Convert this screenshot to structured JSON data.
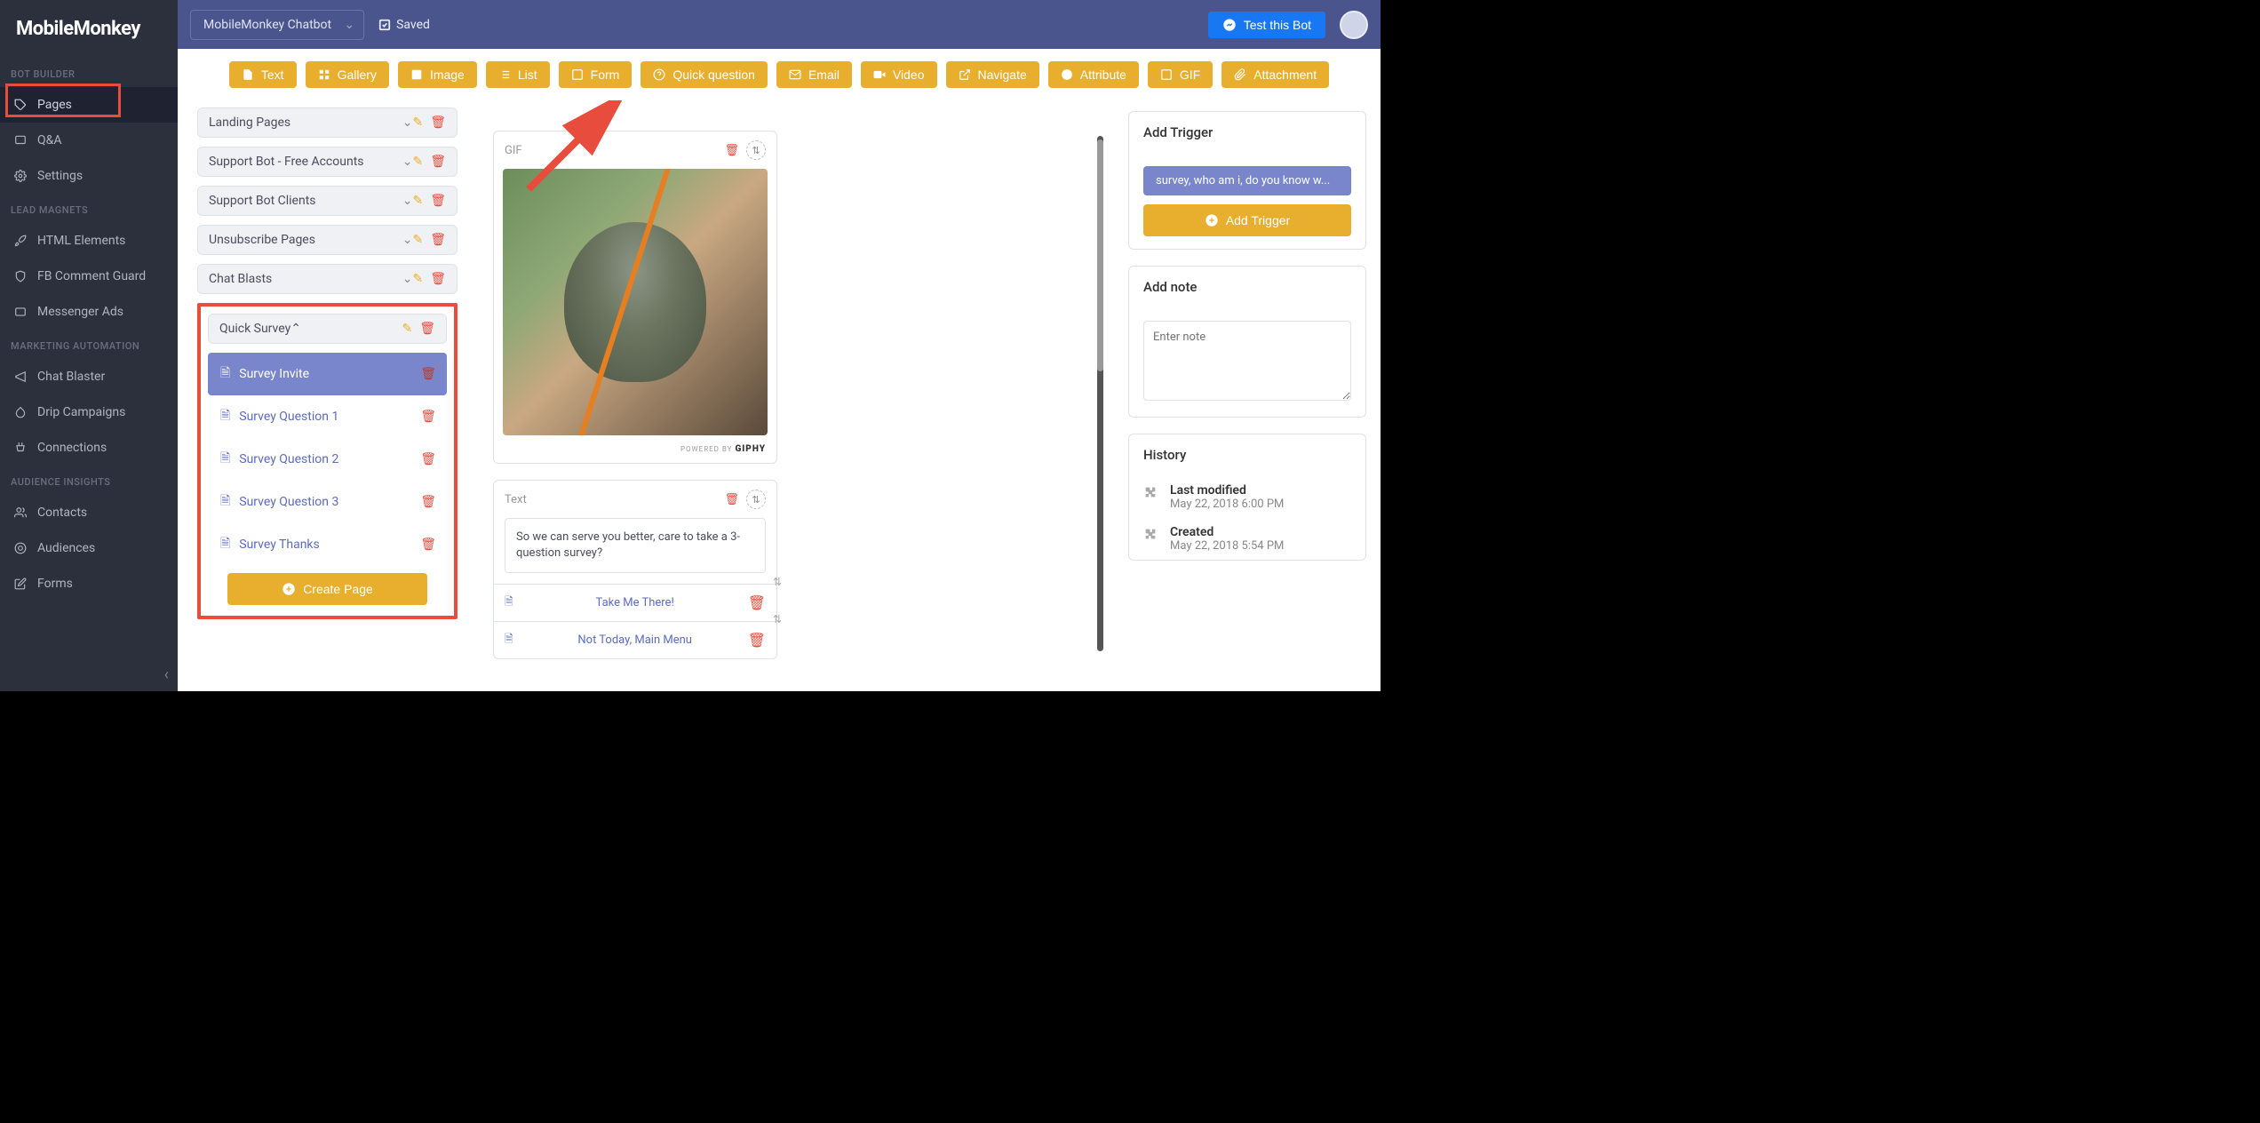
{
  "app_name": "MobileMonkey",
  "header": {
    "chatbot_name": "MobileMonkey Chatbot",
    "saved_label": "Saved",
    "test_bot_label": "Test this Bot"
  },
  "sidebar": {
    "sections": [
      {
        "label": "BOT BUILDER",
        "items": [
          "Pages",
          "Q&A",
          "Settings"
        ]
      },
      {
        "label": "LEAD MAGNETS",
        "items": [
          "HTML Elements",
          "FB Comment Guard",
          "Messenger Ads"
        ]
      },
      {
        "label": "MARKETING AUTOMATION",
        "items": [
          "Chat Blaster",
          "Drip Campaigns",
          "Connections"
        ]
      },
      {
        "label": "AUDIENCE INSIGHTS",
        "items": [
          "Contacts",
          "Audiences",
          "Forms"
        ]
      }
    ]
  },
  "toolbar": [
    "Text",
    "Gallery",
    "Image",
    "List",
    "Form",
    "Quick question",
    "Email",
    "Video",
    "Navigate",
    "Attribute",
    "GIF",
    "Attachment"
  ],
  "folders": [
    "Landing Pages",
    "Support Bot - Free Accounts",
    "Support Bot Clients",
    "Unsubscribe Pages",
    "Chat Blasts"
  ],
  "open_folder": {
    "name": "Quick Survey",
    "pages": [
      "Survey Invite",
      "Survey Question 1",
      "Survey Question 2",
      "Survey Question 3",
      "Survey Thanks"
    ],
    "create_label": "Create Page"
  },
  "canvas": {
    "gif_label": "GIF",
    "giphy_label": "POWERED BY GIPHY",
    "text_label": "Text",
    "text_body": "So we can serve you better, care to take a 3-question survey?",
    "replies": [
      "Take Me There!",
      "Not Today, Main Menu"
    ]
  },
  "right": {
    "trigger_title": "Add Trigger",
    "trigger_chip": "survey, who am i, do you know w...",
    "add_trigger_label": "Add Trigger",
    "note_title": "Add note",
    "note_placeholder": "Enter note",
    "history_title": "History",
    "history": [
      {
        "label": "Last modified",
        "date": "May 22, 2018 6:00 PM"
      },
      {
        "label": "Created",
        "date": "May 22, 2018 5:54 PM"
      }
    ]
  }
}
